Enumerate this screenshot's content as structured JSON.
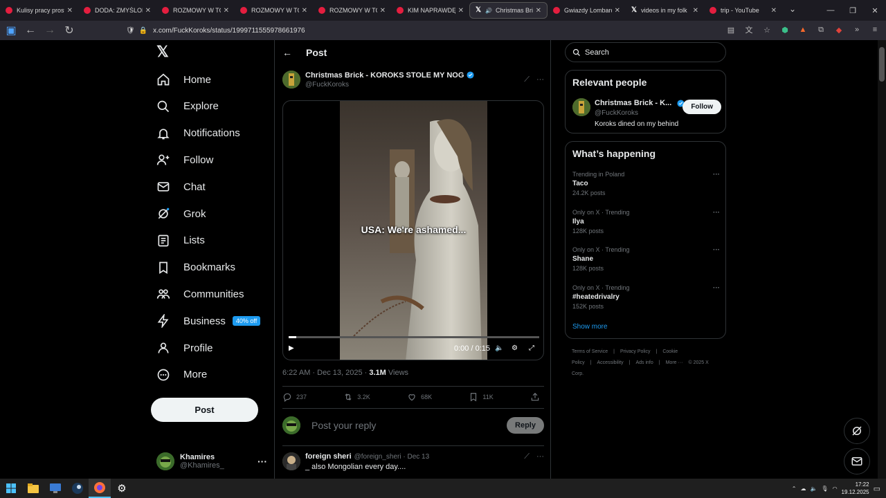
{
  "browser": {
    "tabs": [
      {
        "title": "Kulisy pracy prostytut",
        "favicon": "youtube-icon",
        "active": false
      },
      {
        "title": "DODA: ZMYŚLONE Z",
        "favicon": "youtube-icon",
        "active": false
      },
      {
        "title": "ROZMOWY W TOKU",
        "favicon": "youtube-icon",
        "active": false
      },
      {
        "title": "ROZMOWY W TOKU",
        "favicon": "youtube-icon",
        "active": false
      },
      {
        "title": "ROZMOWY W TOKU",
        "favicon": "youtube-icon",
        "active": false
      },
      {
        "title": "KIM NAPRAWDĘ JEST",
        "favicon": "youtube-icon",
        "active": false
      },
      {
        "title": "Christmas Brick",
        "favicon": "x-icon",
        "active": true
      },
      {
        "title": "Gwiazdy Lombardu: I",
        "favicon": "youtube-icon",
        "active": false
      },
      {
        "title": "videos in my folk",
        "favicon": "x-icon",
        "active": false
      },
      {
        "title": "trip - YouTube",
        "favicon": "youtube-icon",
        "active": false
      }
    ],
    "url": "x.com/FuckKoroks/status/1999711555978661976"
  },
  "sidebar": {
    "items": [
      {
        "label": "Home",
        "icon": "home-icon"
      },
      {
        "label": "Explore",
        "icon": "search-icon"
      },
      {
        "label": "Notifications",
        "icon": "bell-icon"
      },
      {
        "label": "Follow",
        "icon": "person-add-icon"
      },
      {
        "label": "Chat",
        "icon": "mail-icon"
      },
      {
        "label": "Grok",
        "icon": "grok-icon"
      },
      {
        "label": "Lists",
        "icon": "list-icon"
      },
      {
        "label": "Bookmarks",
        "icon": "bookmark-icon"
      },
      {
        "label": "Communities",
        "icon": "communities-icon"
      },
      {
        "label": "Business",
        "icon": "lightning-icon",
        "badge": "40% off"
      },
      {
        "label": "Profile",
        "icon": "person-icon"
      },
      {
        "label": "More",
        "icon": "more-circle-icon"
      }
    ],
    "post_button": "Post",
    "account": {
      "name": "Khamires",
      "handle": "@Khamires_"
    }
  },
  "post": {
    "header_title": "Post",
    "author_name": "Christmas Brick - KOROKS STOLE MY NOG",
    "author_handle": "@FuckKoroks",
    "video_caption": "USA: We're ashamed...",
    "video_time": "0:00 / 0:15",
    "video_progress": 0.03,
    "time": "6:22 AM · Dec 13, 2025 · ",
    "views_count": "3.1M",
    "views_label": " Views",
    "replies": "237",
    "reposts": "3.2K",
    "likes": "68K",
    "bookmarks": "11K",
    "reply_placeholder": "Post your reply",
    "reply_button": "Reply"
  },
  "first_reply": {
    "name": "foreign sheri",
    "handle_date": "@foreign_sheri · Dec 13",
    "text": "_ also Mongolian every day...."
  },
  "right": {
    "search_placeholder": "Search",
    "relevant_title": "Relevant people",
    "person": {
      "name": "Christmas Brick - K...",
      "handle": "@FuckKoroks",
      "bio": "Koroks dined on my behind",
      "follow": "Follow"
    },
    "happening_title": "What’s happening",
    "trends": [
      {
        "context": "Trending in Poland",
        "name": "Taco",
        "count": "24.2K posts"
      },
      {
        "context": "Only on X · Trending",
        "name": "Ilya",
        "count": "128K posts"
      },
      {
        "context": "Only on X · Trending",
        "name": "Shane",
        "count": "128K posts"
      },
      {
        "context": "Only on X · Trending",
        "name": "#heatedrivalry",
        "count": "152K posts"
      }
    ],
    "show_more": "Show more",
    "footer_links": [
      "Terms of Service",
      "|",
      "Privacy Policy",
      "|",
      "Cookie Policy",
      "|",
      "Accessibility",
      "|",
      "Ads info",
      "|",
      "More ···",
      "© 2025 X Corp."
    ]
  },
  "taskbar": {
    "time": "17:22",
    "date": "19.12.2025"
  },
  "colors": {
    "accent": "#1d9bf0",
    "background": "#000000",
    "border": "#2f3336",
    "muted": "#71767b"
  }
}
